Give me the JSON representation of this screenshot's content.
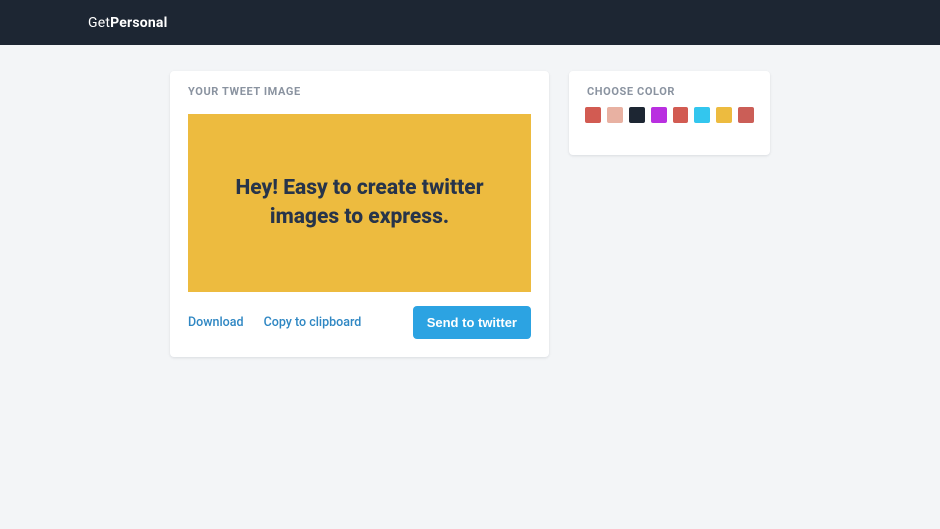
{
  "brand": {
    "pre": "Get",
    "bold": "Personal"
  },
  "tweetCard": {
    "title": "YOUR TWEET IMAGE",
    "imageText": "Hey! Easy to create twitter images to express.",
    "imageBg": "#edbb3f",
    "download": "Download",
    "copy": "Copy to clipboard",
    "send": "Send to twitter"
  },
  "colorCard": {
    "title": "CHOOSE COLOR",
    "swatches": [
      "#d25b52",
      "#e8b1a2",
      "#1d2633",
      "#b92fe0",
      "#d25b52",
      "#33c6ee",
      "#edbb3f",
      "#cb5e57"
    ]
  }
}
